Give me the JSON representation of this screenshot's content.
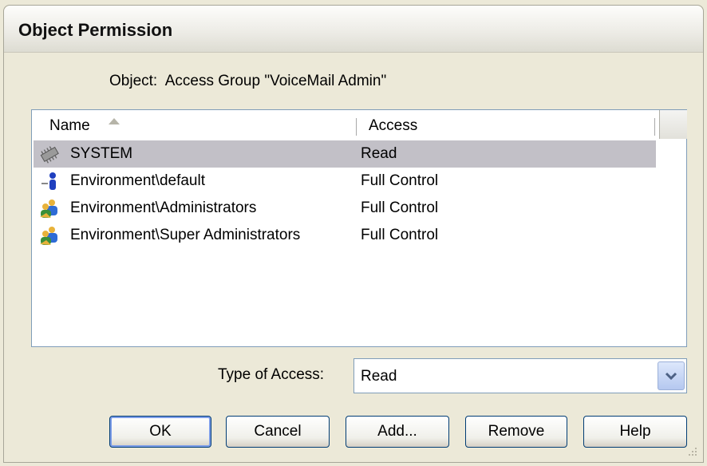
{
  "dialog": {
    "title": "Object Permission",
    "object_label": "Object:",
    "object_value": "Access Group \"VoiceMail Admin\""
  },
  "list": {
    "columns": [
      "Name",
      "Access"
    ],
    "rows": [
      {
        "name": "SYSTEM",
        "access": "Read",
        "icon": "system-chip-icon",
        "selected": true
      },
      {
        "name": "Environment\\default",
        "access": "Full Control",
        "icon": "user-icon",
        "selected": false
      },
      {
        "name": "Environment\\Administrators",
        "access": "Full Control",
        "icon": "user-group-icon",
        "selected": false
      },
      {
        "name": "Environment\\Super Administrators",
        "access": "Full Control",
        "icon": "user-group-icon",
        "selected": false
      }
    ]
  },
  "type_of_access": {
    "label": "Type of Access:",
    "value": "Read"
  },
  "buttons": {
    "ok": "OK",
    "cancel": "Cancel",
    "add": "Add...",
    "remove": "Remove",
    "help": "Help"
  },
  "colors": {
    "selection": "#c2c0c7",
    "button_border": "#003c74",
    "dialog_bg": "#ece9d8"
  }
}
